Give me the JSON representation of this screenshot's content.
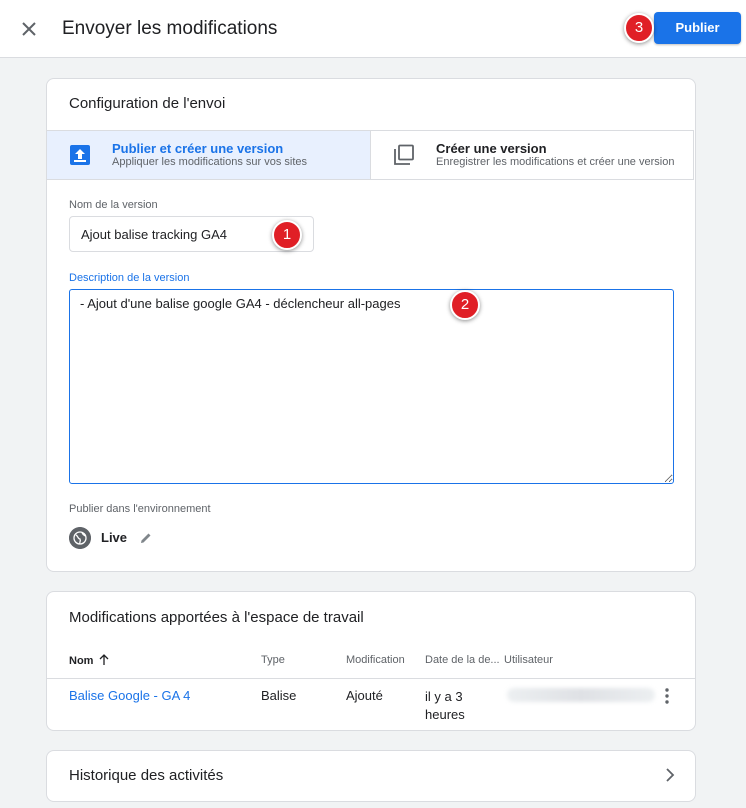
{
  "header": {
    "title": "Envoyer les modifications",
    "publish_label": "Publier"
  },
  "badges": [
    "1",
    "2",
    "3"
  ],
  "config": {
    "title": "Configuration de l'envoi",
    "options": [
      {
        "title": "Publier et créer une version",
        "subtitle": "Appliquer les modifications sur vos sites",
        "icon": "publish-icon",
        "selected": true
      },
      {
        "title": "Créer une version",
        "subtitle": "Enregistrer les modifications et créer une version",
        "icon": "copy-icon",
        "selected": false
      }
    ],
    "version_name_label": "Nom de la version",
    "version_name_value": "Ajout balise tracking GA4",
    "description_label": "Description de la version",
    "description_value": "- Ajout d'une balise google GA4 - déclencheur all-pages",
    "environment_label": "Publier dans l'environnement",
    "environment_value": "Live"
  },
  "changes": {
    "title": "Modifications apportées à l'espace de travail",
    "columns": [
      "Nom",
      "Type",
      "Modification",
      "Date de la de...",
      "Utilisateur"
    ],
    "rows": [
      {
        "name": "Balise Google - GA 4",
        "type": "Balise",
        "modification": "Ajouté",
        "date_line1": "il y a 3",
        "date_line2": "heures"
      }
    ]
  },
  "history": {
    "title": "Historique des activités"
  },
  "colors": {
    "accent": "#1a73e8",
    "badge": "#e01f26",
    "selected_bg": "#e8f0fe"
  }
}
